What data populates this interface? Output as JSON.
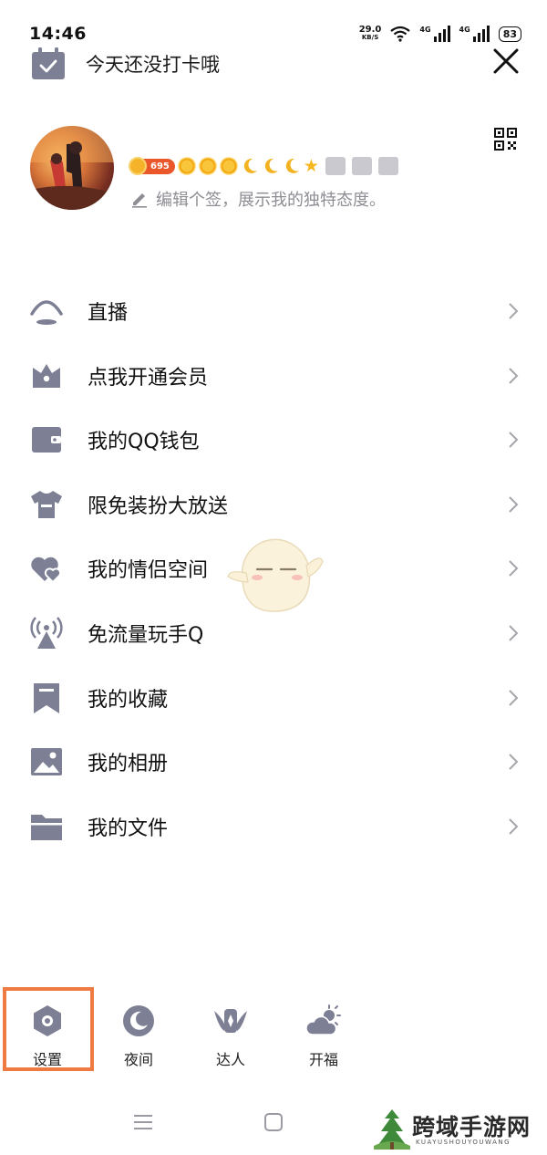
{
  "status_bar": {
    "time": "14:46",
    "net_speed": "29.0",
    "net_unit": "KB/S",
    "sim1": "4G",
    "sim2": "4G",
    "battery": "83"
  },
  "checkin": {
    "label": "今天还没打卡哦",
    "icon": "calendar-check-icon"
  },
  "header": {
    "close_icon": "close-icon",
    "qr_icon": "qr-code-icon"
  },
  "profile": {
    "level": "695",
    "level_icons": [
      "sun-icon",
      "sun-icon",
      "sun-icon",
      "moon-icon",
      "moon-icon",
      "moon-icon",
      "star-icon"
    ],
    "signature": "编辑个签，展示我的独特态度。"
  },
  "menu": {
    "items": [
      {
        "label": "直播",
        "icon": "live-icon"
      },
      {
        "label": "点我开通会员",
        "icon": "vip-crown-icon"
      },
      {
        "label": "我的QQ钱包",
        "icon": "wallet-icon"
      },
      {
        "label": "限免装扮大放送",
        "icon": "tshirt-icon"
      },
      {
        "label": "我的情侣空间",
        "icon": "hearts-icon"
      },
      {
        "label": "免流量玩手Q",
        "icon": "signal-tower-icon"
      },
      {
        "label": "我的收藏",
        "icon": "bookmark-icon"
      },
      {
        "label": "我的相册",
        "icon": "photo-icon"
      },
      {
        "label": "我的文件",
        "icon": "folder-icon"
      }
    ]
  },
  "bottom_bar": {
    "items": [
      {
        "label": "设置",
        "icon": "settings-icon"
      },
      {
        "label": "夜间",
        "icon": "night-mode-icon"
      },
      {
        "label": "达人",
        "icon": "expert-icon"
      },
      {
        "label": "开福",
        "icon": "weather-icon"
      }
    ]
  },
  "watermark": {
    "title": "跨域手游网",
    "subtitle": "KUAYUSHOUYOUWANG"
  },
  "colors": {
    "icon_gray": "#7d7f94",
    "highlight": "#ee7a44",
    "level_pill": "#e9572b"
  }
}
